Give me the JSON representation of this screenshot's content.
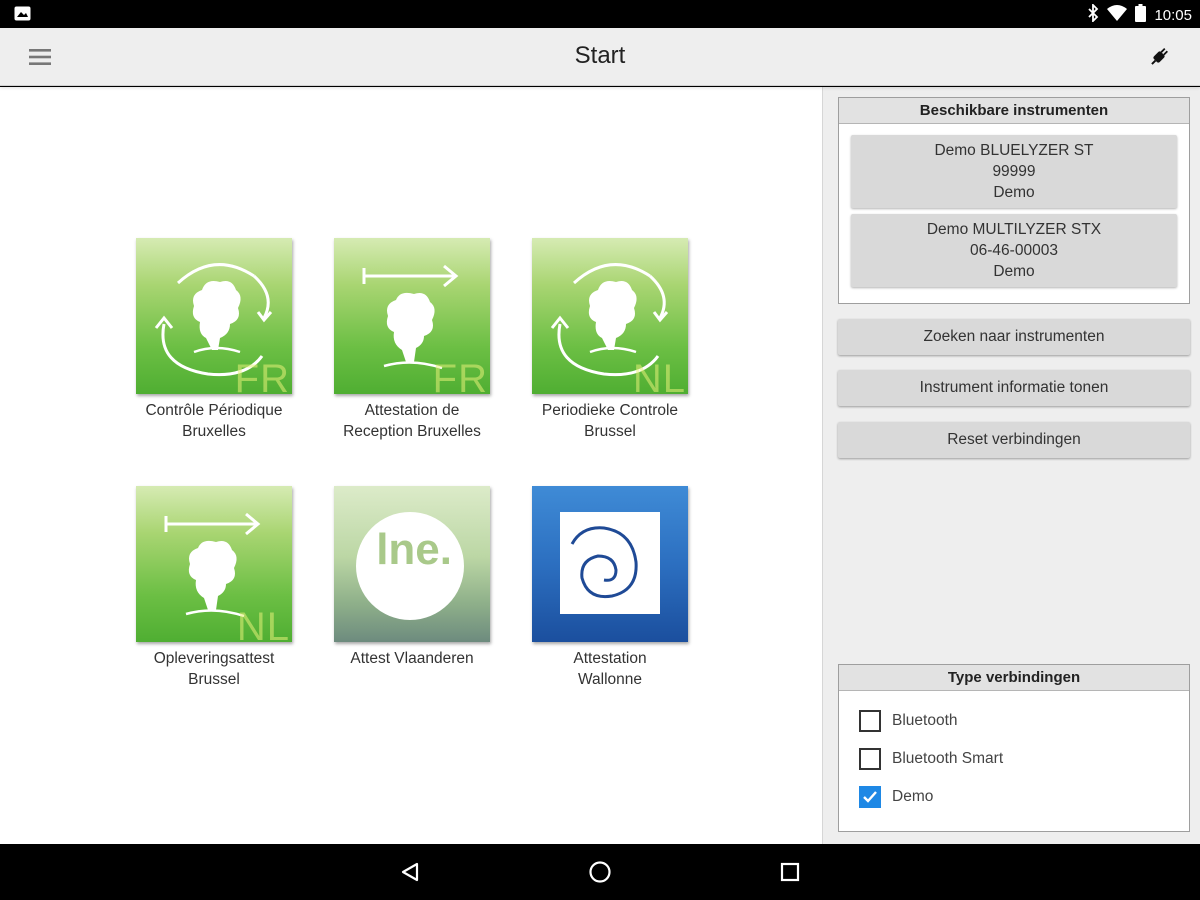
{
  "status_bar": {
    "time": "10:05",
    "icons": [
      "image-notification-icon",
      "bluetooth-icon",
      "wifi-icon",
      "battery-icon"
    ]
  },
  "app_bar": {
    "title": "Start",
    "menu_icon": "hamburger-menu-icon",
    "action_icon": "plug-icon"
  },
  "tiles": [
    {
      "label_line1": "Contrôle Périodique",
      "label_line2": "Bruxelles",
      "lang": "FR",
      "icon": "cycle-tree-icon"
    },
    {
      "label_line1": "Attestation de",
      "label_line2": "Reception Bruxelles",
      "lang": "FR",
      "icon": "arrow-tree-icon"
    },
    {
      "label_line1": "Periodieke Controle",
      "label_line2": "Brussel",
      "lang": "NL",
      "icon": "cycle-tree-icon"
    },
    {
      "label_line1": "Opleveringsattest",
      "label_line2": "Brussel",
      "lang": "NL",
      "icon": "arrow-tree-icon"
    },
    {
      "label_line1": "Attest Vlaanderen",
      "label_line2": "",
      "logo_text": "lne.",
      "icon": "lne-logo"
    },
    {
      "label_line1": "Attestation",
      "label_line2": "Wallonne",
      "icon": "spiral-logo"
    }
  ],
  "instruments_panel": {
    "title": "Beschikbare instrumenten",
    "items": [
      {
        "name": "Demo BLUELYZER ST",
        "serial": "99999",
        "mode": "Demo"
      },
      {
        "name": "Demo MULTILYZER STX",
        "serial": "06-46-00003",
        "mode": "Demo"
      }
    ]
  },
  "actions": {
    "search": "Zoeken naar instrumenten",
    "info": "Instrument informatie tonen",
    "reset": "Reset verbindingen"
  },
  "connection_panel": {
    "title": "Type verbindingen",
    "options": [
      {
        "label": "Bluetooth",
        "checked": false
      },
      {
        "label": "Bluetooth Smart",
        "checked": false
      },
      {
        "label": "Demo",
        "checked": true
      }
    ]
  },
  "colors": {
    "checkbox_accent": "#1e88e5",
    "tile_green": "#6cbf44",
    "wallonne_blue": "#2c6fc0"
  },
  "nav_bar": {
    "icons": [
      "back-icon",
      "home-icon",
      "recents-icon"
    ]
  }
}
